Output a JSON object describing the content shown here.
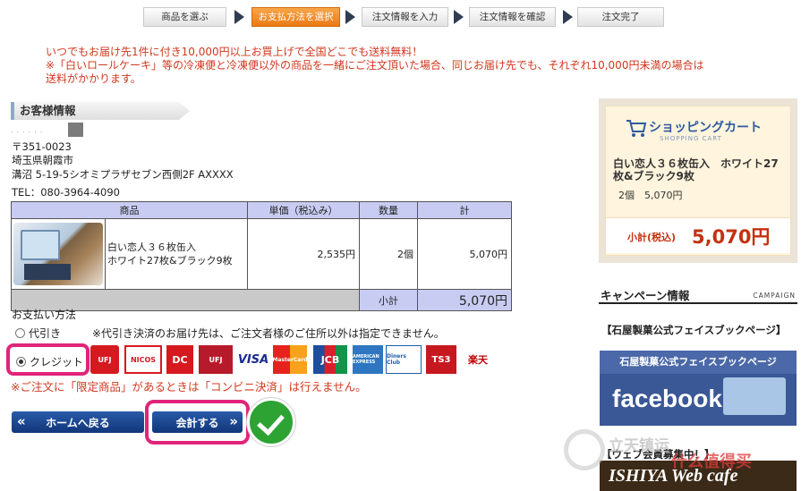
{
  "steps": [
    {
      "label": "商品を選ぶ",
      "active": false
    },
    {
      "label": "お支払方法を選択",
      "active": true
    },
    {
      "label": "注文情報を入力",
      "active": false
    },
    {
      "label": "注文情報を確認",
      "active": false
    },
    {
      "label": "注文完了",
      "active": false
    }
  ],
  "notice": {
    "line1": "いつでもお届け先1件に付き10,000円以上お買上げで全国どこでも送料無料！",
    "line2": "※「白いロールケーキ」等の冷凍便と冷凍便以外の商品を一緒にご注文頂いた場合、同じお届け先でも、それぞれ10,000円未満の場合は",
    "line3": "送料がかかります。"
  },
  "customer": {
    "heading": "お客様情報",
    "postal": "〒351-0023",
    "address1": "埼玉県朝霞市",
    "address2": "溝沼 5-19-5シオミプラザセブン西側2F AXXXX",
    "tel": "TEL：080-3964-4090"
  },
  "table": {
    "headers": [
      "商品",
      "単価（税込み）",
      "数量",
      "計"
    ],
    "rows": [
      {
        "name": "白い恋人３６枚缶入\nホワイト27枚&ブラック9枚",
        "price": "2,535円",
        "qty": "2個",
        "total": "5,070円"
      }
    ],
    "subtotal_label": "小計",
    "subtotal_value": "5,070円"
  },
  "payment": {
    "label": "お支払い方法",
    "option_cod": "代引き",
    "cod_note": "※代引き決済のお届け先は、ご注文者様のご住所以外は指定できません。",
    "option_credit": "クレジット",
    "selected": "credit",
    "warning": "※ご注文に「限定商品」があるときは「コンビニ決済」は行えません。"
  },
  "card_brands": [
    "UFJ",
    "NICOS",
    "DC",
    "UFJ",
    "VISA",
    "MasterCard",
    "JCB",
    "AMERICAN EXPRESS",
    "Diners Club",
    "TS3",
    "楽天"
  ],
  "buttons": {
    "home": "ホームへ戻る",
    "checkout": "会計する"
  },
  "cart": {
    "title": "ショッピングカート",
    "subtitle": "SHOPPING CART",
    "product": "白い恋人３６枚缶入　ホワイト27枚&ブラック9枚",
    "qty_price": "2個　5,070円",
    "total_label": "小計(税込)",
    "total_value": "5,070円"
  },
  "campaign": {
    "title": "キャンペーン情報",
    "title_en": "CAMPAIGN",
    "fb_title": "【石屋製菓公式フェイスブックページ】",
    "fb_banner_top": "石屋製菓公式フェイスブックページ",
    "fb_logo": "facebook",
    "web_title": "【ウェブ会員募集中！】",
    "web_banner": "ISHIYA Web cafe"
  },
  "watermark": {
    "text1": "立天镇运",
    "text2": "什么值得买"
  },
  "colors": {
    "accent_orange": "#ea7a16",
    "notice_red": "#d0381e",
    "highlight_pink": "#e0247a",
    "button_blue": "#1d4690",
    "check_green": "#2da334",
    "table_header": "#c8ccf2"
  }
}
